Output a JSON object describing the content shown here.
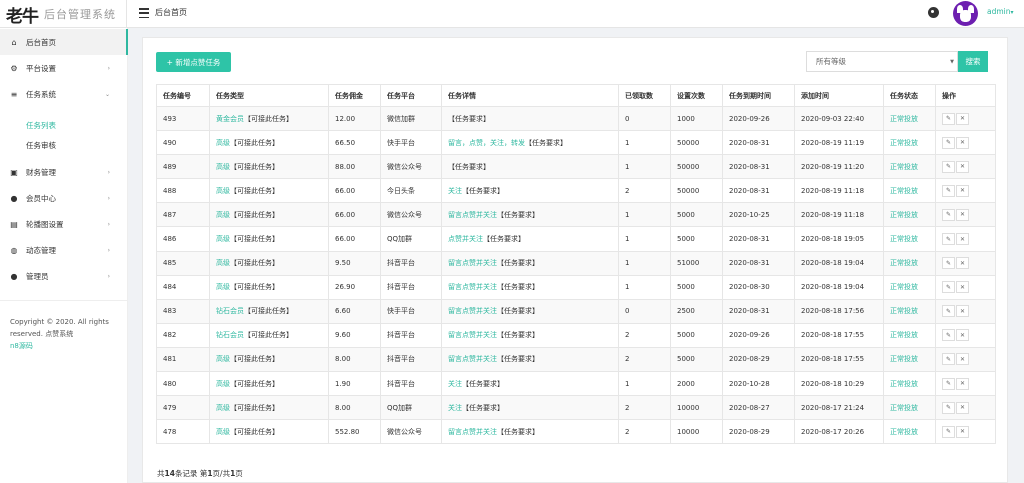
{
  "header": {
    "logo_mark": "老牛",
    "logo_text": "后台管理系统",
    "breadcrumb": "后台首页",
    "username": "admin"
  },
  "sidebar": {
    "items": [
      {
        "label": "后台首页",
        "icon": "home-icon"
      },
      {
        "label": "平台设置",
        "icon": "gear-icon"
      },
      {
        "label": "任务系统",
        "icon": "list-icon"
      },
      {
        "label": "财务管理",
        "icon": "money-icon"
      },
      {
        "label": "会员中心",
        "icon": "user-icon"
      },
      {
        "label": "轮播图设置",
        "icon": "image-icon"
      },
      {
        "label": "动态管理",
        "icon": "globe-icon"
      },
      {
        "label": "管理员",
        "icon": "admin-icon"
      }
    ],
    "subitems": [
      "任务列表",
      "任务审核"
    ],
    "copyright": "Copyright © 2020. All rights reserved. 点赞系统",
    "copyright_link": "n8源码"
  },
  "toolbar": {
    "add_label": "+ 新增点赞任务",
    "select_value": "所有等级",
    "search_label": "搜索"
  },
  "table": {
    "headers": [
      "任务编号",
      "任务类型",
      "任务佣金",
      "任务平台",
      "任务详情",
      "已领取数",
      "设置次数",
      "任务到期时间",
      "添加时间",
      "任务状态",
      "操作"
    ],
    "rows": [
      {
        "id": "493",
        "level": "黄金会员",
        "type": "【可接此任务】",
        "commission": "12.00",
        "platform": "微信加群",
        "detail_hl": "",
        "detail": "【任务要求】",
        "received": "0",
        "times": "1000",
        "expire": "2020-09-26",
        "added": "2020-09-03 22:40",
        "status": "正常投放"
      },
      {
        "id": "490",
        "level": "高级",
        "type": "【可接此任务】",
        "commission": "66.50",
        "platform": "快手平台",
        "detail_hl": "留言，点赞，关注，转发",
        "detail": "【任务要求】",
        "received": "1",
        "times": "50000",
        "expire": "2020-08-31",
        "added": "2020-08-19 11:19",
        "status": "正常投放"
      },
      {
        "id": "489",
        "level": "高级",
        "type": "【可接此任务】",
        "commission": "88.00",
        "platform": "微信公众号",
        "detail_hl": "",
        "detail": "【任务要求】",
        "received": "1",
        "times": "50000",
        "expire": "2020-08-31",
        "added": "2020-08-19 11:20",
        "status": "正常投放"
      },
      {
        "id": "488",
        "level": "高级",
        "type": "【可接此任务】",
        "commission": "66.00",
        "platform": "今日头条",
        "detail_hl": "关注",
        "detail": "【任务要求】",
        "received": "2",
        "times": "50000",
        "expire": "2020-08-31",
        "added": "2020-08-19 11:18",
        "status": "正常投放"
      },
      {
        "id": "487",
        "level": "高级",
        "type": "【可接此任务】",
        "commission": "66.00",
        "platform": "微信公众号",
        "detail_hl": "留言点赞并关注",
        "detail": "【任务要求】",
        "received": "1",
        "times": "5000",
        "expire": "2020-10-25",
        "added": "2020-08-19 11:18",
        "status": "正常投放"
      },
      {
        "id": "486",
        "level": "高级",
        "type": "【可接此任务】",
        "commission": "66.00",
        "platform": "QQ加群",
        "detail_hl": "点赞并关注",
        "detail": "【任务要求】",
        "received": "1",
        "times": "5000",
        "expire": "2020-08-31",
        "added": "2020-08-18 19:05",
        "status": "正常投放"
      },
      {
        "id": "485",
        "level": "高级",
        "type": "【可接此任务】",
        "commission": "9.50",
        "platform": "抖音平台",
        "detail_hl": "留言点赞并关注",
        "detail": "【任务要求】",
        "received": "1",
        "times": "51000",
        "expire": "2020-08-31",
        "added": "2020-08-18 19:04",
        "status": "正常投放"
      },
      {
        "id": "484",
        "level": "高级",
        "type": "【可接此任务】",
        "commission": "26.90",
        "platform": "抖音平台",
        "detail_hl": "留言点赞并关注",
        "detail": "【任务要求】",
        "received": "1",
        "times": "5000",
        "expire": "2020-08-30",
        "added": "2020-08-18 19:04",
        "status": "正常投放"
      },
      {
        "id": "483",
        "level": "钻石会员",
        "type": "【可接此任务】",
        "commission": "6.60",
        "platform": "快手平台",
        "detail_hl": "留言点赞并关注",
        "detail": "【任务要求】",
        "received": "0",
        "times": "2500",
        "expire": "2020-08-31",
        "added": "2020-08-18 17:56",
        "status": "正常投放"
      },
      {
        "id": "482",
        "level": "钻石会员",
        "type": "【可接此任务】",
        "commission": "9.60",
        "platform": "抖音平台",
        "detail_hl": "留言点赞并关注",
        "detail": "【任务要求】",
        "received": "2",
        "times": "5000",
        "expire": "2020-09-26",
        "added": "2020-08-18 17:55",
        "status": "正常投放"
      },
      {
        "id": "481",
        "level": "高级",
        "type": "【可接此任务】",
        "commission": "8.00",
        "platform": "抖音平台",
        "detail_hl": "留言点赞并关注",
        "detail": "【任务要求】",
        "received": "2",
        "times": "5000",
        "expire": "2020-08-29",
        "added": "2020-08-18 17:55",
        "status": "正常投放"
      },
      {
        "id": "480",
        "level": "高级",
        "type": "【可接此任务】",
        "commission": "1.90",
        "platform": "抖音平台",
        "detail_hl": "关注",
        "detail": "【任务要求】",
        "received": "1",
        "times": "2000",
        "expire": "2020-10-28",
        "added": "2020-08-18 10:29",
        "status": "正常投放"
      },
      {
        "id": "479",
        "level": "高级",
        "type": "【可接此任务】",
        "commission": "8.00",
        "platform": "QQ加群",
        "detail_hl": "关注",
        "detail": "【任务要求】",
        "received": "2",
        "times": "10000",
        "expire": "2020-08-27",
        "added": "2020-08-17 21:24",
        "status": "正常投放"
      },
      {
        "id": "478",
        "level": "高级",
        "type": "【可接此任务】",
        "commission": "552.80",
        "platform": "微信公众号",
        "detail_hl": "留言点赞并关注",
        "detail": "【任务要求】",
        "received": "2",
        "times": "10000",
        "expire": "2020-08-29",
        "added": "2020-08-17 20:26",
        "status": "正常投放"
      }
    ]
  },
  "pager": {
    "prefix": "共",
    "total": "14",
    "mid1": "条记录 第",
    "page": "1",
    "mid2": "页/共",
    "pages": "1",
    "suffix": "页"
  },
  "colors": {
    "accent": "#2ec4a7",
    "link": "#2fb8a0",
    "avatar": "#6d1fb0"
  }
}
